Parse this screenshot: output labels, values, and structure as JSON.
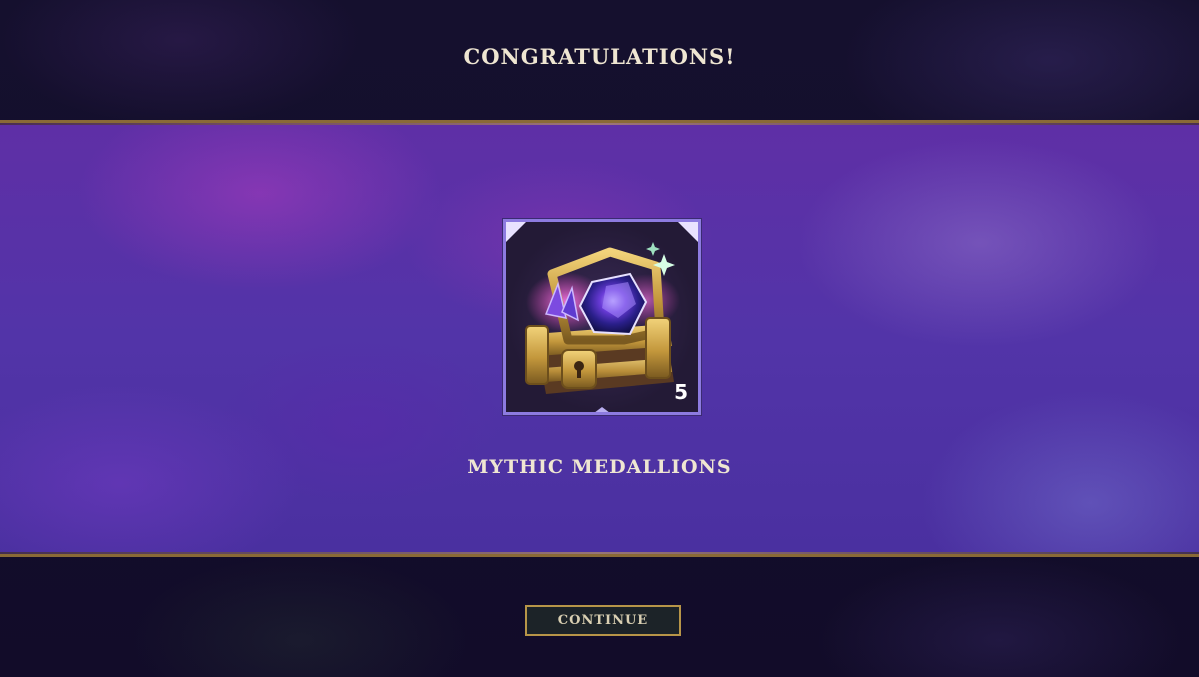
{
  "header": {
    "title": "CONGRATULATIONS!"
  },
  "reward": {
    "name": "MYTHIC MEDALLIONS",
    "count": "5",
    "icon": "mythic-chest-icon"
  },
  "footer": {
    "continue_label": "CONTINUE"
  },
  "colors": {
    "accent_gold": "#b79548",
    "band_purple": "#5234a8",
    "card_border": "#8d7be0",
    "text_cream": "#efe6d2"
  }
}
